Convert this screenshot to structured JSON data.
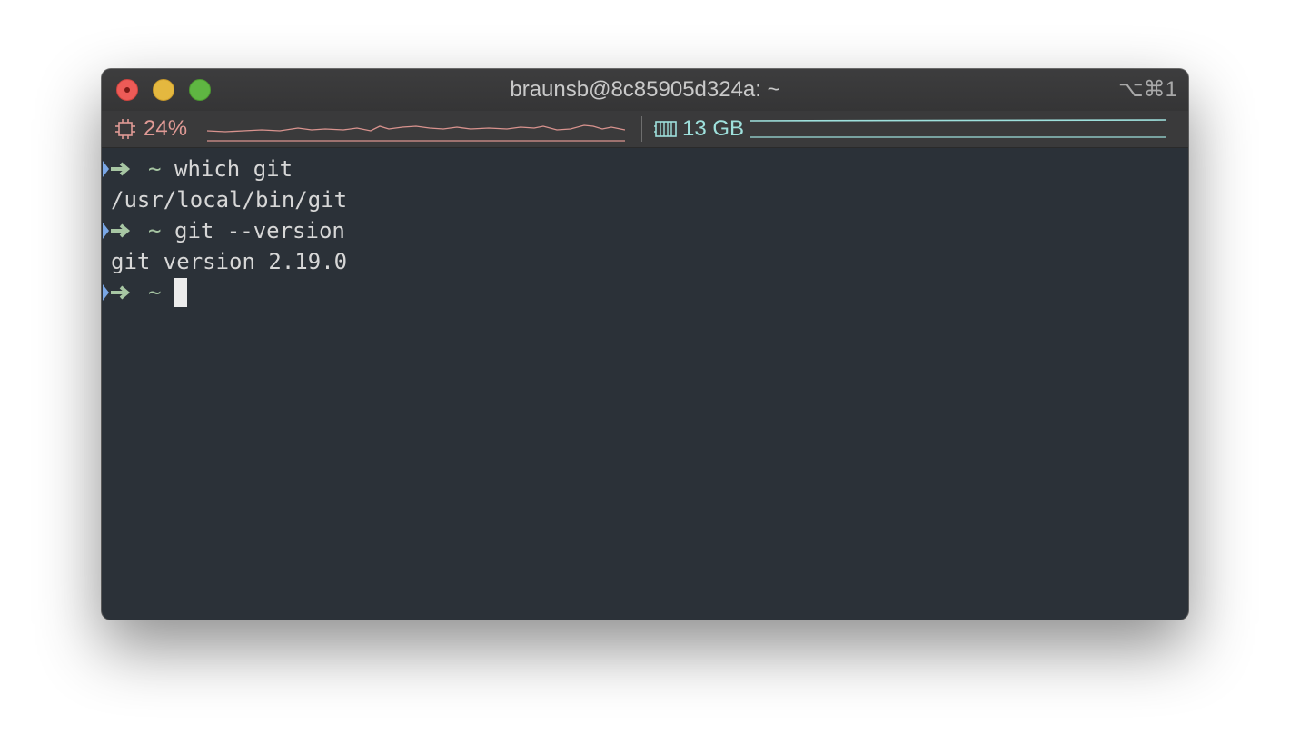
{
  "window": {
    "title": "braunsb@8c85905d324a: ~",
    "shortcut": "⌥⌘1"
  },
  "status": {
    "cpu": {
      "icon": "cpu-chip-icon",
      "value": "24%",
      "color": "#e09a95"
    },
    "memory": {
      "icon": "memory-icon",
      "value": "13 GB",
      "color": "#9ee0dc"
    }
  },
  "terminal": {
    "prompt_dir": "~",
    "lines": [
      {
        "type": "prompt",
        "command": "which git"
      },
      {
        "type": "output",
        "text": "/usr/local/bin/git"
      },
      {
        "type": "prompt",
        "command": "git --version"
      },
      {
        "type": "output",
        "text": "git version 2.19.0"
      },
      {
        "type": "prompt",
        "command": ""
      }
    ]
  },
  "colors": {
    "background": "#2b3138",
    "prompt_arrow": "#a7c6a3",
    "prompt_caret": "#7aa7e6"
  }
}
